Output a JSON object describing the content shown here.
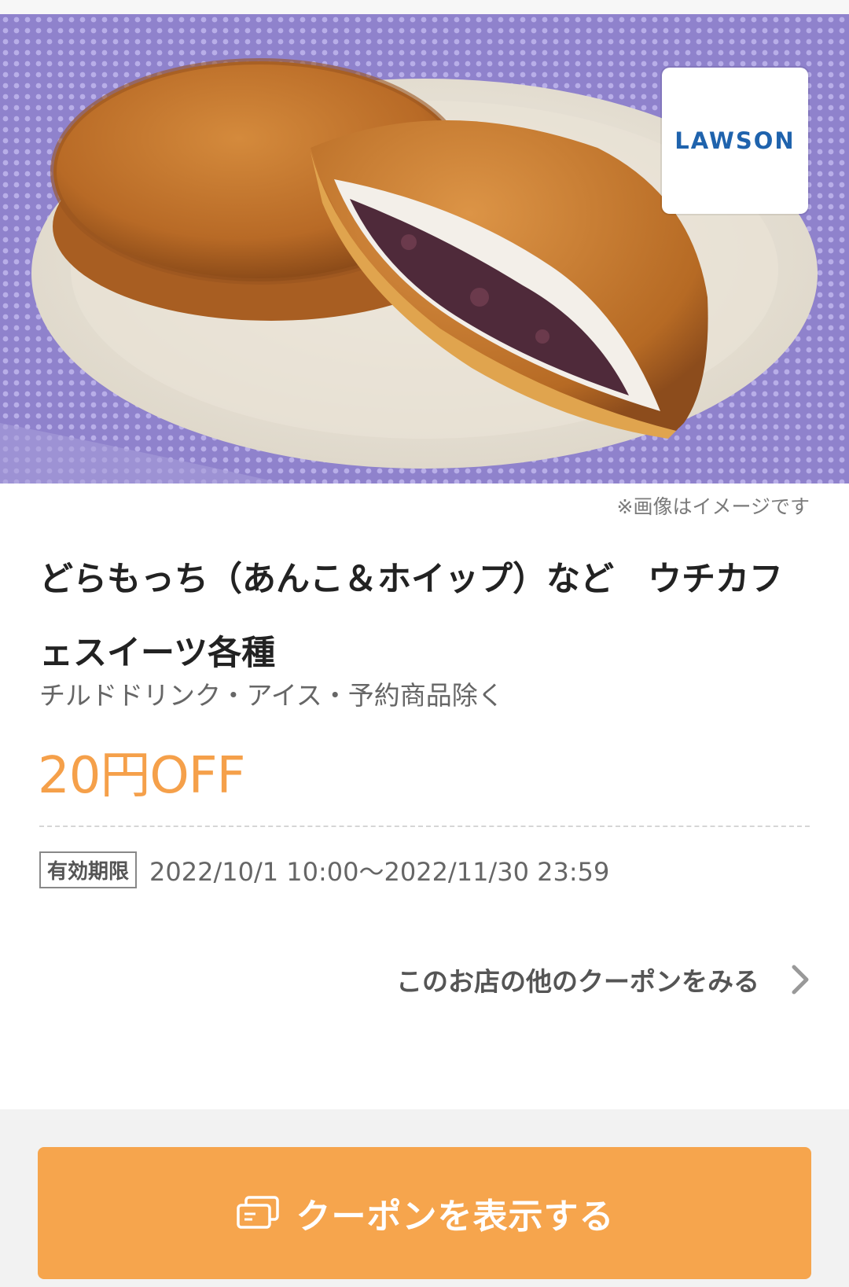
{
  "hero": {
    "brand_logo": "LAWSON",
    "image_note": "※画像はイメージです"
  },
  "coupon": {
    "title": "どらもっち（あんこ＆ホイップ）など　ウチカフェスイーツ各種",
    "exclusion": "チルドドリンク・アイス・予約商品除く",
    "discount": "20円OFF",
    "validity_label": "有効期限",
    "validity_dates": "2022/10/1 10:00〜2022/11/30 23:59"
  },
  "links": {
    "more_coupons": "このお店の他のクーポンをみる"
  },
  "footer": {
    "show_button_label": "クーポンを表示する"
  },
  "colors": {
    "accent": "#f6a54d",
    "discount_text": "#f5a04a",
    "logo_blue": "#1f63ad",
    "background_purple": "#8f82cc"
  },
  "icons": {
    "chevron": "chevron-right-icon",
    "coupon": "coupon-cards-icon"
  }
}
